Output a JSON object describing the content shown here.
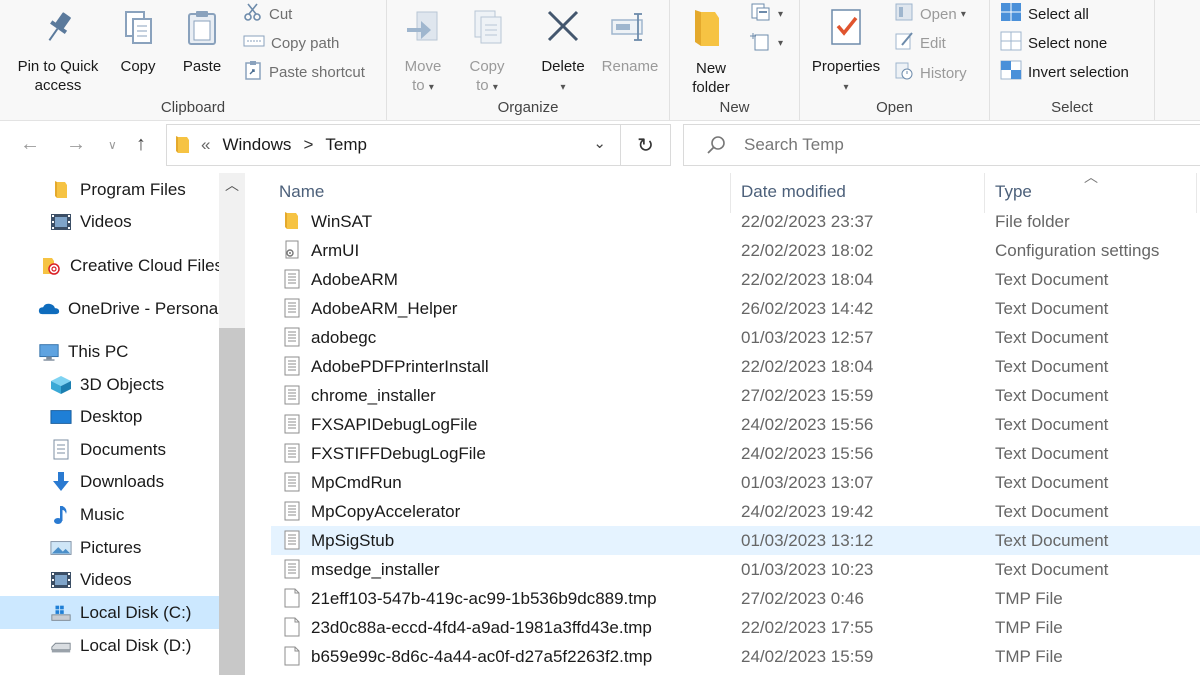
{
  "ribbon": {
    "clipboard": {
      "label": "Clipboard",
      "pin_label_1": "Pin to Quick",
      "pin_label_2": "access",
      "copy_label": "Copy",
      "paste_label": "Paste",
      "cut_label": "Cut",
      "copy_path_label": "Copy path",
      "paste_shortcut_label": "Paste shortcut"
    },
    "organize": {
      "label": "Organize",
      "move_to_1": "Move",
      "move_to_2": "to",
      "copy_to_1": "Copy",
      "copy_to_2": "to",
      "delete_label": "Delete",
      "rename_label": "Rename"
    },
    "new": {
      "label": "New",
      "new_folder_1": "New",
      "new_folder_2": "folder"
    },
    "open": {
      "label": "Open",
      "properties_label": "Properties",
      "open_label": "Open",
      "edit_label": "Edit",
      "history_label": "History"
    },
    "select": {
      "label": "Select",
      "select_all": "Select all",
      "select_none": "Select none",
      "invert_selection": "Invert selection"
    }
  },
  "address": {
    "overflow": "«",
    "crumb_1": "Windows",
    "separator": ">",
    "crumb_2": "Temp",
    "search_placeholder": "Search Temp"
  },
  "nav": {
    "items": [
      {
        "label": "Program Files",
        "icon": "folder-icon"
      },
      {
        "label": "Videos",
        "icon": "videos-icon"
      },
      {
        "label": "Creative Cloud Files",
        "icon": "creative-cloud-icon"
      },
      {
        "label": "OneDrive - Personal",
        "icon": "onedrive-icon"
      },
      {
        "label": "This PC",
        "icon": "pc-icon"
      },
      {
        "label": "3D Objects",
        "icon": "3d-objects-icon"
      },
      {
        "label": "Desktop",
        "icon": "desktop-icon"
      },
      {
        "label": "Documents",
        "icon": "documents-icon"
      },
      {
        "label": "Downloads",
        "icon": "downloads-icon"
      },
      {
        "label": "Music",
        "icon": "music-icon"
      },
      {
        "label": "Pictures",
        "icon": "pictures-icon"
      },
      {
        "label": "Videos",
        "icon": "videos-icon"
      },
      {
        "label": "Local Disk (C:)",
        "icon": "windows-drive-icon"
      },
      {
        "label": "Local Disk (D:)",
        "icon": "drive-icon"
      }
    ]
  },
  "files": {
    "columns": {
      "name": "Name",
      "date": "Date modified",
      "type": "Type"
    },
    "rows": [
      {
        "name": "WinSAT",
        "date": "22/02/2023 23:37",
        "type": "File folder",
        "icon": "folder-icon"
      },
      {
        "name": "ArmUI",
        "date": "22/02/2023 18:02",
        "type": "Configuration settings",
        "icon": "config-icon"
      },
      {
        "name": "AdobeARM",
        "date": "22/02/2023 18:04",
        "type": "Text Document",
        "icon": "text-file-icon"
      },
      {
        "name": "AdobeARM_Helper",
        "date": "26/02/2023 14:42",
        "type": "Text Document",
        "icon": "text-file-icon"
      },
      {
        "name": "adobegc",
        "date": "01/03/2023 12:57",
        "type": "Text Document",
        "icon": "text-file-icon"
      },
      {
        "name": "AdobePDFPrinterInstall",
        "date": "22/02/2023 18:04",
        "type": "Text Document",
        "icon": "text-file-icon"
      },
      {
        "name": "chrome_installer",
        "date": "27/02/2023 15:59",
        "type": "Text Document",
        "icon": "text-file-icon"
      },
      {
        "name": "FXSAPIDebugLogFile",
        "date": "24/02/2023 15:56",
        "type": "Text Document",
        "icon": "text-file-icon"
      },
      {
        "name": "FXSTIFFDebugLogFile",
        "date": "24/02/2023 15:56",
        "type": "Text Document",
        "icon": "text-file-icon"
      },
      {
        "name": "MpCmdRun",
        "date": "01/03/2023 13:07",
        "type": "Text Document",
        "icon": "text-file-icon"
      },
      {
        "name": "MpCopyAccelerator",
        "date": "24/02/2023 19:42",
        "type": "Text Document",
        "icon": "text-file-icon"
      },
      {
        "name": "MpSigStub",
        "date": "01/03/2023 13:12",
        "type": "Text Document",
        "icon": "text-file-icon",
        "selected": true
      },
      {
        "name": "msedge_installer",
        "date": "01/03/2023 10:23",
        "type": "Text Document",
        "icon": "text-file-icon"
      },
      {
        "name": "21eff103-547b-419c-ac99-1b536b9dc889.tmp",
        "date": "27/02/2023 0:46",
        "type": "TMP File",
        "icon": "blank-file-icon"
      },
      {
        "name": "23d0c88a-eccd-4fd4-a9ad-1981a3ffd43e.tmp",
        "date": "22/02/2023 17:55",
        "type": "TMP File",
        "icon": "blank-file-icon"
      },
      {
        "name": "b659e99c-8d6c-4a44-ac0f-d27a5f2263f2.tmp",
        "date": "24/02/2023 15:59",
        "type": "TMP File",
        "icon": "blank-file-icon"
      }
    ]
  },
  "colors": {
    "accent": "#0078d4",
    "selection": "#e5f3ff",
    "folder": "#f8c948"
  }
}
